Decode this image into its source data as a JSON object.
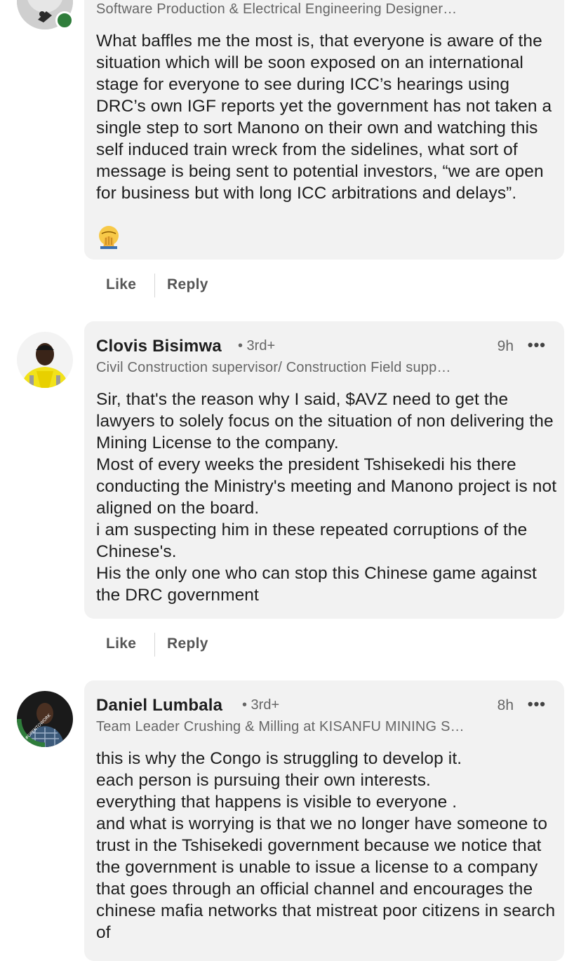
{
  "comments": [
    {
      "headline": "Software Production & Electrical Engineering Designer…",
      "body": "What baffles me the most is, that everyone is aware of the situation which will be soon exposed on an international stage for everyone to see during ICC’s hearings using DRC’s own IGF reports yet the government has not taken a single step to sort Manono on their own and watching this self induced train wreck from the sidelines, what sort of message is being sent to potential investors, “we are open for business but with long ICC arbitrations and delays”.",
      "emoji": "face-palm",
      "like_label": "Like",
      "reply_label": "Reply"
    },
    {
      "name": "Clovis Bisimwa",
      "degree": "• 3rd+",
      "time": "9h",
      "more": "•••",
      "headline": "Civil Construction supervisor/ Construction Field supp…",
      "body": "Sir, that's the  reason why I said, $AVZ need to get the lawyers to solely focus on the situation of non delivering the Mining License to the company.\nMost of every weeks the president Tshisekedi his there conducting the Ministry's  meeting and Manono project is not aligned on the board.\ni am suspecting him in these repeated corruptions of the Chinese's.\nHis the only one who can stop this Chinese game against the DRC government",
      "like_label": "Like",
      "reply_label": "Reply"
    },
    {
      "name": "Daniel Lumbala",
      "degree": "• 3rd+",
      "time": "8h",
      "more": "•••",
      "headline": "Team Leader Crushing & Milling at KISANFU MINING S…",
      "body": "this is why the Congo is struggling to develop it.\neach person is pursuing their own interests.\neverything that happens is visible to everyone .\nand what is worrying is that we no longer have someone to trust in the Tshisekedi government because we notice that the government is unable to issue a license to a company that goes through an official channel and encourages the chinese mafia networks that mistreat poor citizens in search of",
      "avatar_badge": "#OPENTOWORK"
    }
  ],
  "colors": {
    "bubble": "#f2f2f2",
    "online": "#2f7d3b",
    "open_to_work": "#2f7d3b"
  }
}
